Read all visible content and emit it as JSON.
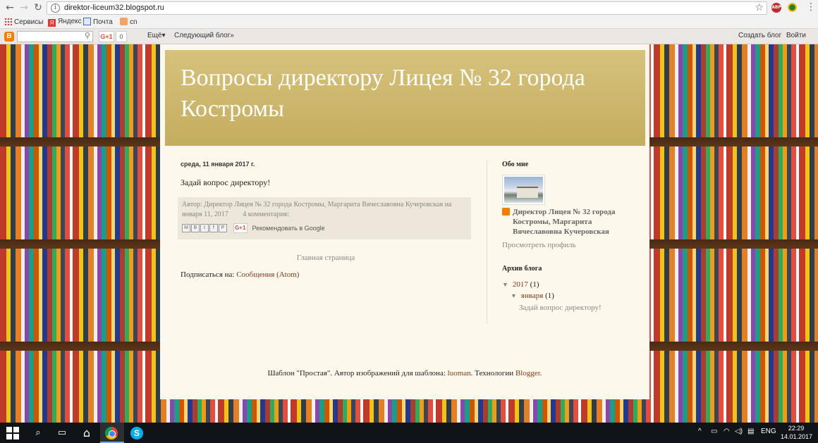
{
  "browser": {
    "url": "direktor-liceum32.blogspot.ru",
    "bookmarks": [
      {
        "label": "Сервисы"
      },
      {
        "label": "Яндекс"
      },
      {
        "label": "Почта"
      },
      {
        "label": "cn"
      }
    ],
    "ext_badge": "ABP"
  },
  "navbar": {
    "logo": "B",
    "gplus": "G+1",
    "gplus_count": "0",
    "more": "Ещё▾",
    "next_blog": "Следующий блог»",
    "create_blog": "Создать блог",
    "sign_in": "Войти"
  },
  "blog": {
    "title": "Вопросы директору Лицея № 32 города Костромы"
  },
  "post": {
    "date": "среда, 11 января 2017 г.",
    "title": "Задай вопрос директору!",
    "author_prefix": "Автор:",
    "author": "Директор Лицея № 32 города Костромы, Маргарита Вячеславовна Кучеровская",
    "on": "на",
    "timestamp": "января 11, 2017",
    "comments": "4 комментария:",
    "share_icons": [
      "M",
      "B",
      "t",
      "f",
      "P"
    ],
    "gplus": "G+1",
    "recommend": "Рекомендовать в Google"
  },
  "home_link": "Главная страница",
  "subscribe": {
    "prefix": "Подписаться на:",
    "link": "Сообщения (Atom)"
  },
  "sidebar": {
    "about_header": "Обо мне",
    "profile_name": "Директор Лицея № 32 города Костромы, Маргарита Вячеславовна Кучеровская",
    "view_profile": "Просмотреть профиль",
    "archive_header": "Архив блога",
    "year": "2017",
    "year_count": "(1)",
    "month": "января",
    "month_count": "(1)",
    "archive_post": "Задай вопрос директору!"
  },
  "attribution": {
    "text1": "Шаблон \"Простая\". Автор изображений для шаблона:",
    "author": "luoman",
    "text2": ". Технологии",
    "blogger": "Blogger",
    "end": "."
  },
  "taskbar": {
    "lang": "ENG",
    "time": "22:29",
    "date": "14.01.2017"
  }
}
